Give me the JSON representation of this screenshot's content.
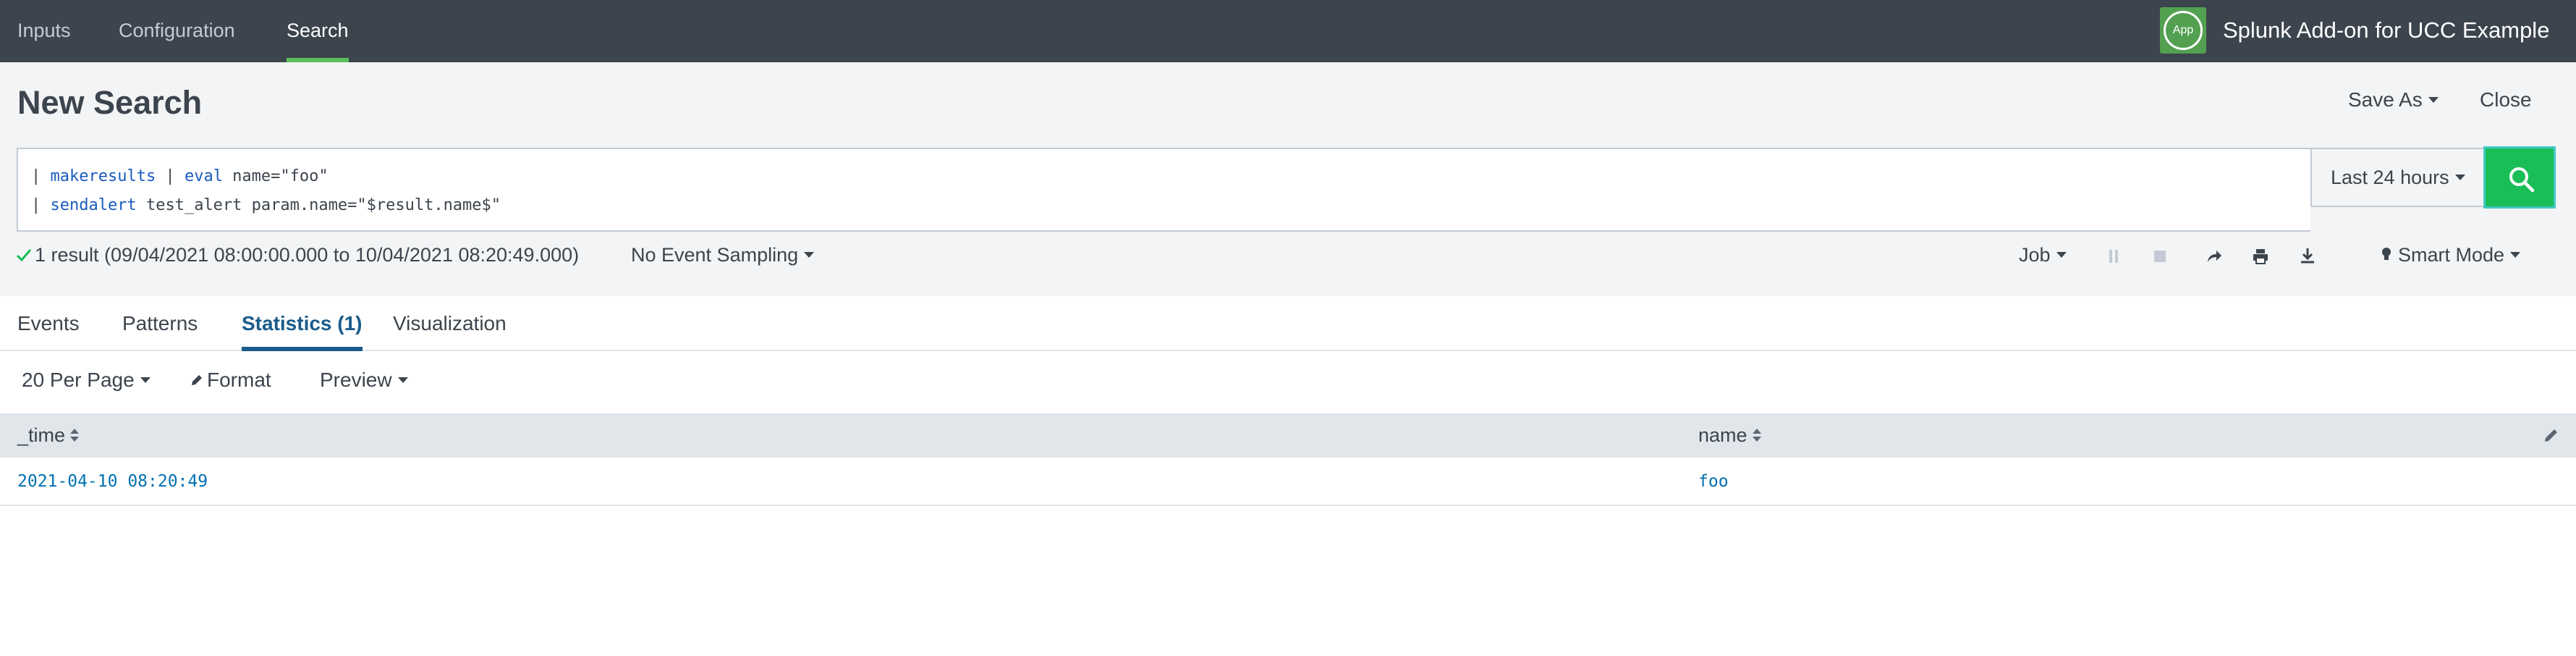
{
  "nav": {
    "items": [
      {
        "label": "Inputs"
      },
      {
        "label": "Configuration"
      },
      {
        "label": "Search"
      }
    ],
    "app_badge": "App",
    "app_title": "Splunk Add-on for UCC Example"
  },
  "header": {
    "title": "New Search",
    "save_as": "Save As",
    "close": "Close"
  },
  "search": {
    "line1": {
      "pipe": "| ",
      "cmd1": "makeresults",
      "mid": " | ",
      "cmd2": "eval",
      "rest": " name=\"foo\""
    },
    "line2": {
      "pipe": "| ",
      "cmd": "sendalert",
      "rest": " test_alert param.name=\"$result.name$\""
    },
    "time_range": "Last 24 hours"
  },
  "status": {
    "result_text": "1 result (09/04/2021 08:00:00.000 to 10/04/2021 08:20:49.000)",
    "event_sampling": "No Event Sampling",
    "job": "Job",
    "smart_mode": "Smart Mode"
  },
  "tabs": [
    {
      "label": "Events"
    },
    {
      "label": "Patterns"
    },
    {
      "label": "Statistics (1)"
    },
    {
      "label": "Visualization"
    }
  ],
  "toolbar": {
    "per_page": "20 Per Page",
    "format": "Format",
    "preview": "Preview"
  },
  "table": {
    "columns": [
      "_time",
      "name"
    ],
    "rows": [
      [
        "2021-04-10 08:20:49",
        "foo"
      ]
    ]
  },
  "colors": {
    "topbar": "#3c444d",
    "accent_green": "#5cc05c",
    "search_button": "#1abe57",
    "keyword_blue": "#1a5bbd",
    "link_blue": "#0070b0",
    "active_tab": "#1a5b8c"
  },
  "icons": [
    "app-icon",
    "caret-down-icon",
    "search-icon",
    "check-icon",
    "pause-icon",
    "stop-icon",
    "share-icon",
    "print-icon",
    "export-icon",
    "lightbulb-icon",
    "pencil-icon",
    "sort-icon",
    "edit-columns-icon"
  ]
}
